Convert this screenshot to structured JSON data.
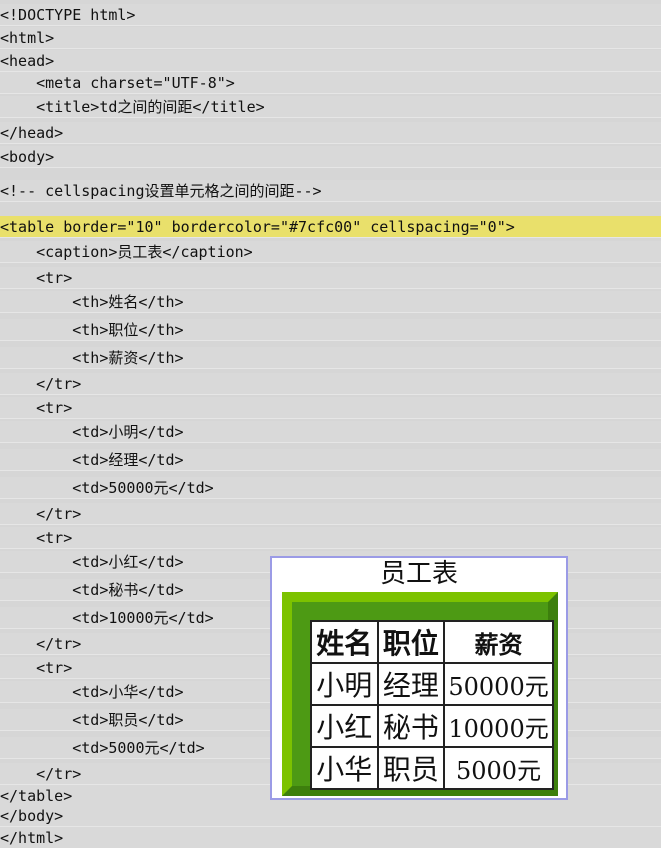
{
  "code_lines": [
    {
      "text": "<!DOCTYPE html>",
      "highlight": false
    },
    {
      "text": "<html>",
      "highlight": false
    },
    {
      "text": "<head>",
      "highlight": false
    },
    {
      "text": "    <meta charset=\"UTF-8\">",
      "highlight": false
    },
    {
      "text": "    <title>td之间的间距</title>",
      "highlight": false
    },
    {
      "text": "</head>",
      "highlight": false
    },
    {
      "text": "<body>",
      "highlight": false
    },
    {
      "text": "<!-- cellspacing设置单元格之间的间距-->",
      "highlight": false
    },
    {
      "text": "<table border=\"10\" bordercolor=\"#7cfc00\" cellspacing=\"0\">",
      "highlight": true
    },
    {
      "text": "    <caption>员工表</caption>",
      "highlight": false
    },
    {
      "text": "    <tr>",
      "highlight": false
    },
    {
      "text": "        <th>姓名</th>",
      "highlight": false
    },
    {
      "text": "        <th>职位</th>",
      "highlight": false
    },
    {
      "text": "        <th>薪资</th>",
      "highlight": false
    },
    {
      "text": "    </tr>",
      "highlight": false
    },
    {
      "text": "    <tr>",
      "highlight": false
    },
    {
      "text": "        <td>小明</td>",
      "highlight": false
    },
    {
      "text": "        <td>经理</td>",
      "highlight": false
    },
    {
      "text": "        <td>50000元</td>",
      "highlight": false
    },
    {
      "text": "    </tr>",
      "highlight": false
    },
    {
      "text": "    <tr>",
      "highlight": false
    },
    {
      "text": "        <td>小红</td>",
      "highlight": false
    },
    {
      "text": "        <td>秘书</td>",
      "highlight": false
    },
    {
      "text": "        <td>10000元</td>",
      "highlight": false
    },
    {
      "text": "    </tr>",
      "highlight": false
    },
    {
      "text": "    <tr>",
      "highlight": false
    },
    {
      "text": "        <td>小华</td>",
      "highlight": false
    },
    {
      "text": "        <td>职员</td>",
      "highlight": false
    },
    {
      "text": "        <td>5000元</td>",
      "highlight": false
    },
    {
      "text": "    </tr>",
      "highlight": false
    },
    {
      "text": "</table>",
      "highlight": false
    },
    {
      "text": "</body>",
      "highlight": false
    },
    {
      "text": "</html>",
      "highlight": false
    }
  ],
  "preview": {
    "caption": "员工表",
    "headers": [
      "姓名",
      "职位",
      "薪资"
    ],
    "rows": [
      [
        "小明",
        "经理",
        "50000元"
      ],
      [
        "小红",
        "秘书",
        "10000元"
      ],
      [
        "小华",
        "职员",
        "5000元"
      ]
    ]
  },
  "colors": {
    "highlight": "#e9e06b",
    "table_border_light": "#7cc200",
    "table_border_dark": "#3d7f0d",
    "preview_frame": "#9b9be6"
  }
}
